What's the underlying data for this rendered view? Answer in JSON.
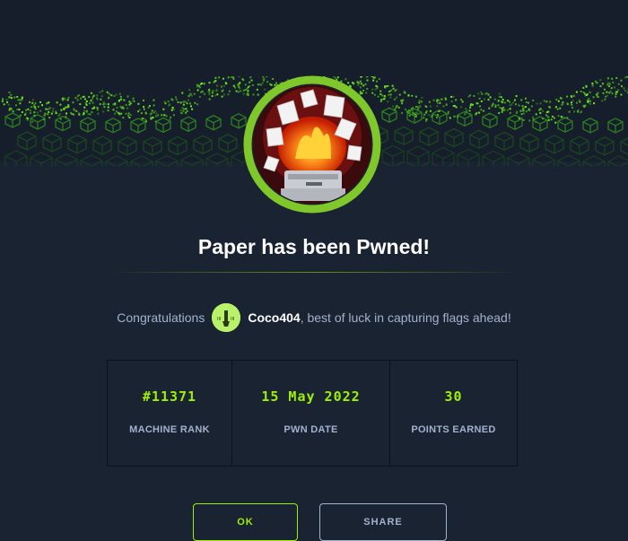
{
  "title": "Paper has been Pwned!",
  "congrats": {
    "prefix": "Congratulations",
    "username": "Coco404",
    "suffix": ", best of luck in capturing flags ahead!"
  },
  "stats": [
    {
      "value": "#11371",
      "label": "MACHINE RANK"
    },
    {
      "value": "15 May 2022",
      "label": "PWN DATE"
    },
    {
      "value": "30",
      "label": "POINTS EARNED"
    }
  ],
  "buttons": {
    "ok": "OK",
    "share": "SHARE"
  },
  "colors": {
    "accent": "#9fef00",
    "background": "#1a2332",
    "muted_text": "#a4b1cd"
  },
  "icons": {
    "machine_avatar": "burning-printer-icon",
    "user_avatar": "user-avatar-icon"
  }
}
